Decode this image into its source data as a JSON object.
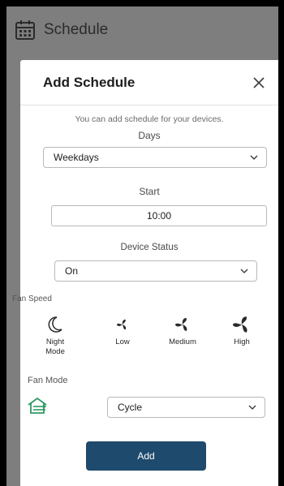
{
  "header": {
    "title": "Schedule",
    "icon": "calendar-icon"
  },
  "modal": {
    "title": "Add Schedule",
    "subtitle": "You can add schedule for your devices.",
    "days": {
      "label": "Days",
      "value": "Weekdays"
    },
    "start": {
      "label": "Start",
      "value": "10:00"
    },
    "device_status": {
      "label": "Device Status",
      "value": "On"
    },
    "fan_speed": {
      "label": "Fan Speed",
      "options": [
        {
          "label_line1": "Night",
          "label_line2": "Mode",
          "icon": "moon-icon"
        },
        {
          "label": "Low",
          "icon": "fan-icon"
        },
        {
          "label": "Medium",
          "icon": "fan-icon"
        },
        {
          "label": "High",
          "icon": "fan-icon"
        }
      ]
    },
    "fan_mode": {
      "label": "Fan Mode",
      "value": "Cycle",
      "icon": "fan-mode-icon"
    },
    "add_label": "Add"
  },
  "colors": {
    "button": "#1e4a6d",
    "mode_icon": "#2f9a63",
    "overlay": "#7e7e7e"
  }
}
